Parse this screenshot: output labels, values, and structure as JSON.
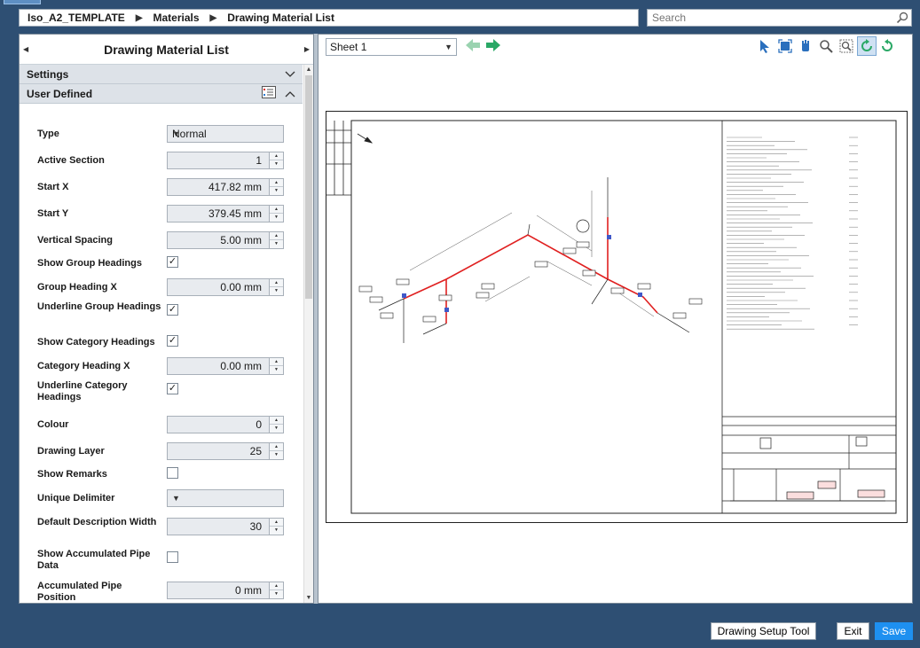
{
  "breadcrumb": {
    "items": [
      "Iso_A2_TEMPLATE",
      "Materials",
      "Drawing Material List"
    ]
  },
  "search": {
    "placeholder": "Search"
  },
  "left_panel": {
    "title": "Drawing Material List",
    "sections": {
      "settings": "Settings",
      "user_defined": "User Defined"
    },
    "properties": [
      {
        "label": "Type",
        "kind": "select",
        "value": "Normal"
      },
      {
        "label": "Active Section",
        "kind": "number",
        "value": "1"
      },
      {
        "label": "Start X",
        "kind": "number",
        "value": "417.82 mm"
      },
      {
        "label": "Start Y",
        "kind": "number",
        "value": "379.45 mm"
      },
      {
        "label": "Vertical Spacing",
        "kind": "number",
        "value": "5.00 mm"
      },
      {
        "label": "Show Group Headings",
        "kind": "checkbox",
        "checked": true
      },
      {
        "label": "Group Heading X",
        "kind": "number",
        "value": "0.00 mm"
      },
      {
        "label": "Underline Group Headings",
        "kind": "checkbox",
        "checked": true
      },
      {
        "label": "Show Category Headings",
        "kind": "checkbox",
        "checked": true
      },
      {
        "label": "Category Heading X",
        "kind": "number",
        "value": "0.00 mm"
      },
      {
        "label": "Underline Category Headings",
        "kind": "checkbox",
        "checked": true
      },
      {
        "label": "Colour",
        "kind": "number",
        "value": "0"
      },
      {
        "label": "Drawing Layer",
        "kind": "number",
        "value": "25"
      },
      {
        "label": "Show Remarks",
        "kind": "checkbox",
        "checked": false
      },
      {
        "label": "Unique Delimiter",
        "kind": "select",
        "value": ""
      },
      {
        "label": "Default Description Width",
        "kind": "number",
        "value": "30"
      },
      {
        "label": "Show Accumulated Pipe Data",
        "kind": "checkbox",
        "checked": false
      },
      {
        "label": "Accumulated Pipe Position",
        "kind": "number",
        "value": "0 mm"
      }
    ]
  },
  "viewer": {
    "sheet": "Sheet 1",
    "tools": [
      "select-arrow-icon",
      "zoom-extents-icon",
      "pan-hand-icon",
      "zoom-icon",
      "zoom-window-icon",
      "refresh-icon",
      "redraw-icon"
    ],
    "colors": {
      "pipe": "#e02020",
      "accent": "#1e90f0",
      "nav_arrow": "#2aa866"
    }
  },
  "buttons": {
    "drawing_setup": "Drawing Setup Tool",
    "exit": "Exit",
    "save": "Save"
  }
}
